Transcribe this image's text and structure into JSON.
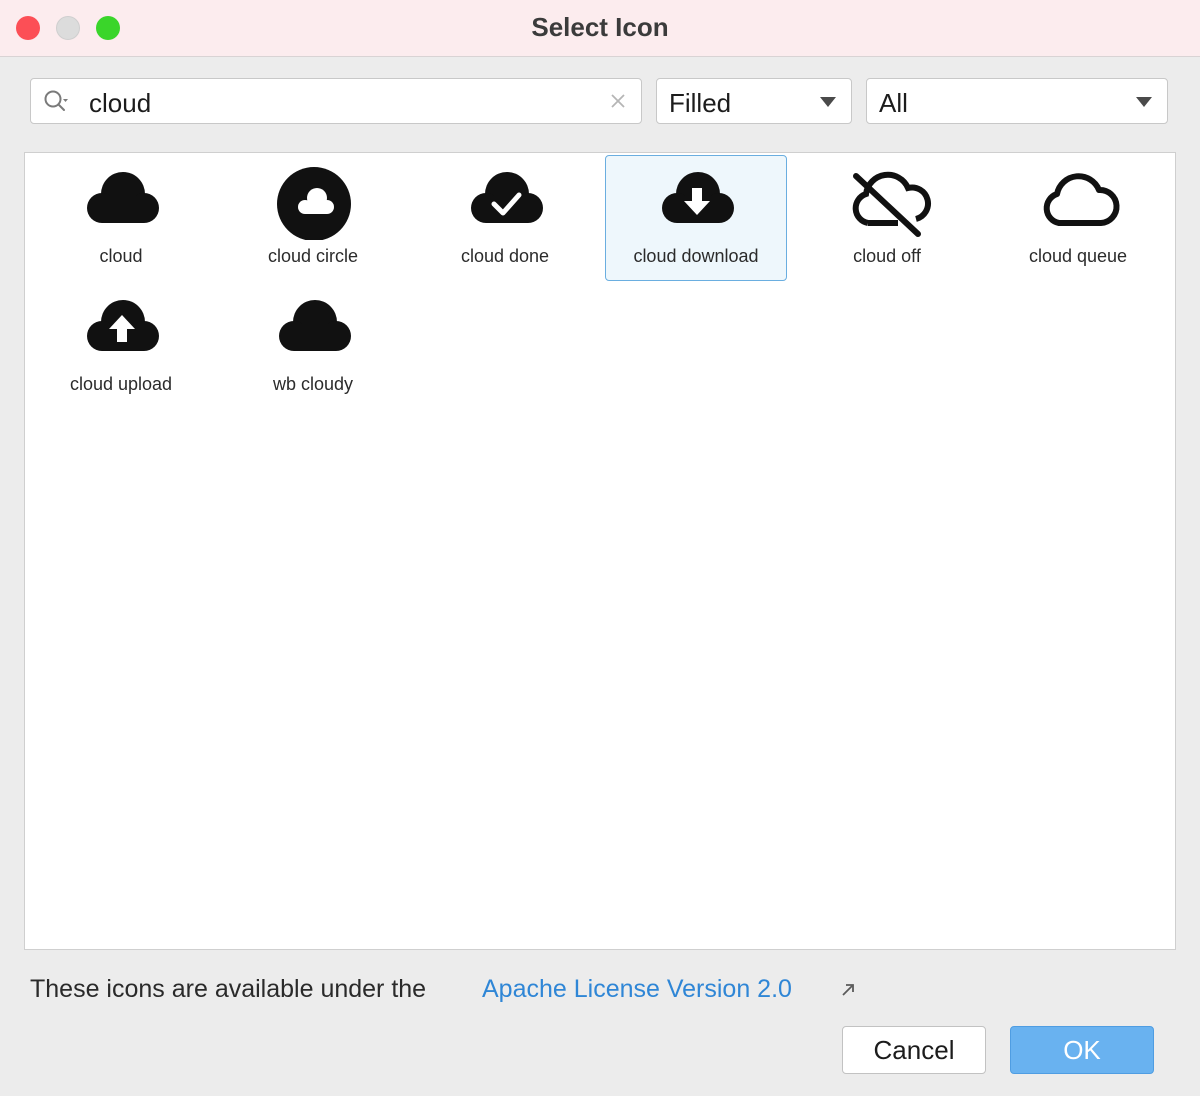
{
  "window": {
    "title": "Select Icon",
    "traffic_lights": {
      "close": "#fc4f56",
      "minimize": "#dcdcdc",
      "maximize": "#3ad52a"
    }
  },
  "search": {
    "value": "cloud",
    "icon": "search-icon",
    "clear_icon": "clear-icon"
  },
  "style_dropdown": {
    "selected": "Filled"
  },
  "category_dropdown": {
    "selected": "All"
  },
  "icons": [
    {
      "label": "cloud",
      "icon": "cloud-icon",
      "selected": false
    },
    {
      "label": "cloud circle",
      "icon": "cloud-circle-icon",
      "selected": false
    },
    {
      "label": "cloud done",
      "icon": "cloud-done-icon",
      "selected": false
    },
    {
      "label": "cloud download",
      "icon": "cloud-download-icon",
      "selected": true
    },
    {
      "label": "cloud off",
      "icon": "cloud-off-icon",
      "selected": false
    },
    {
      "label": "cloud queue",
      "icon": "cloud-queue-icon",
      "selected": false
    },
    {
      "label": "cloud upload",
      "icon": "cloud-upload-icon",
      "selected": false
    },
    {
      "label": "wb cloudy",
      "icon": "wb-cloudy-icon",
      "selected": false
    }
  ],
  "footer": {
    "text": "These icons are available under the",
    "link": "Apache License Version 2.0"
  },
  "buttons": {
    "cancel": "Cancel",
    "ok": "OK"
  },
  "colors": {
    "accent": "#69b2f0",
    "link": "#2f86d6",
    "selection": "#eef7fc"
  }
}
